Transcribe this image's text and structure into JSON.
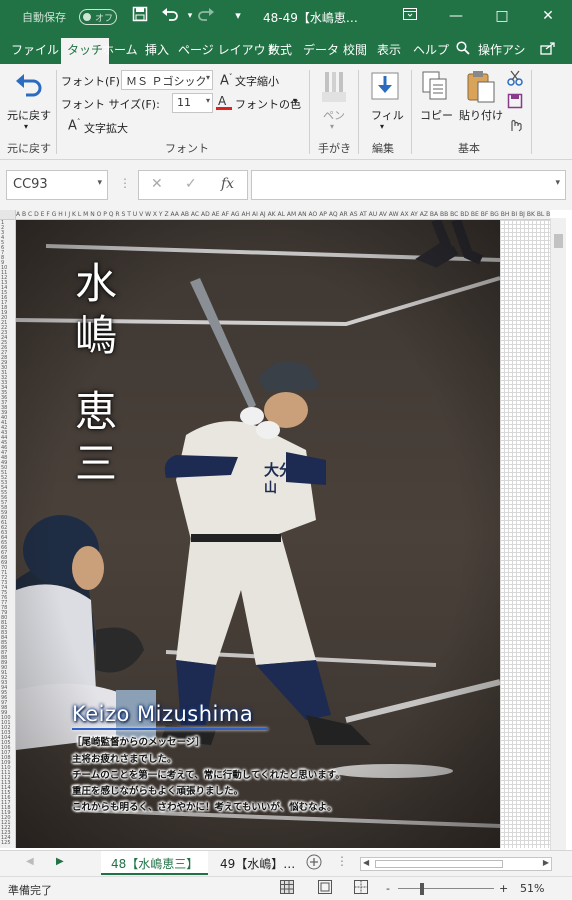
{
  "titlebar": {
    "autosave_label": "自動保存",
    "autosave_state": "オフ",
    "window_title": "48-49【水嶋恵…",
    "minimize": "—",
    "maximize": "□",
    "close": "✕"
  },
  "tabs": [
    "ファイル",
    "タッチ",
    "ホーム",
    "挿入",
    "ページ レイアウト",
    "数式",
    "データ",
    "校閲",
    "表示",
    "ヘルプ",
    "操作アシ"
  ],
  "active_tab": "タッチ",
  "ribbon": {
    "undo_label": "元に戻す",
    "undo_group": "元に戻す",
    "font_label": "フォント(F):",
    "font_value": "ＭＳ Ｐゴシック",
    "size_label": "フォント サイズ(F):",
    "size_value": "11",
    "shrink_label": "文字縮小",
    "grow_label": "文字拡大",
    "font_color_label": "フォントの色",
    "font_group": "フォント",
    "pen_label": "ペン",
    "handwriting_group": "手がき",
    "fill_label": "フィル",
    "edit_group": "編集",
    "copy_label": "コピー",
    "paste_label": "貼り付け",
    "basic_group": "基本"
  },
  "formula_bar": {
    "name_box": "CC93",
    "fx": "fx",
    "formula_value": ""
  },
  "sheet": {
    "column_headers": "A B C D E F G H I J K L M N O P Q R S T U V W X Y Z AA AB AC AD AE AF AG AH AI AJ AK AL AM AN AO AP AQ AR AS AT AU AV AW AX AY AZ BA BB BC BD BE BF BG BH BI BJ BK BL BM BN BO BP BQ BR BS BT BU BV BW BX BY",
    "player_name_vertical": [
      "水",
      "嶋",
      "恵",
      "三"
    ],
    "player_name_romaji": "Keizo Mizushima",
    "message_lines": [
      "［尾崎監督からのメッセージ］",
      "主将お疲れさまでした。",
      "チームのことを第一に考えて、常に行動してくれたと思います。",
      "重圧を感じながらもよく頑張りました。",
      "これからも明るく、さわやかに！考えてもいいが、悩むなよ。"
    ],
    "uniform_text": "大分",
    "uniform_text2": "山"
  },
  "sheet_tabs": [
    "48【水嶋恵三】",
    "49【水嶋】…"
  ],
  "active_sheet": "48【水嶋恵三】",
  "status": {
    "ready": "準備完了",
    "zoom": "51%",
    "zoom_minus": "-",
    "zoom_plus": "+"
  },
  "colors": {
    "excel_green": "#217346",
    "ribbon_bg": "#f3f3f3",
    "romaji_underline": "#2f62c9"
  }
}
